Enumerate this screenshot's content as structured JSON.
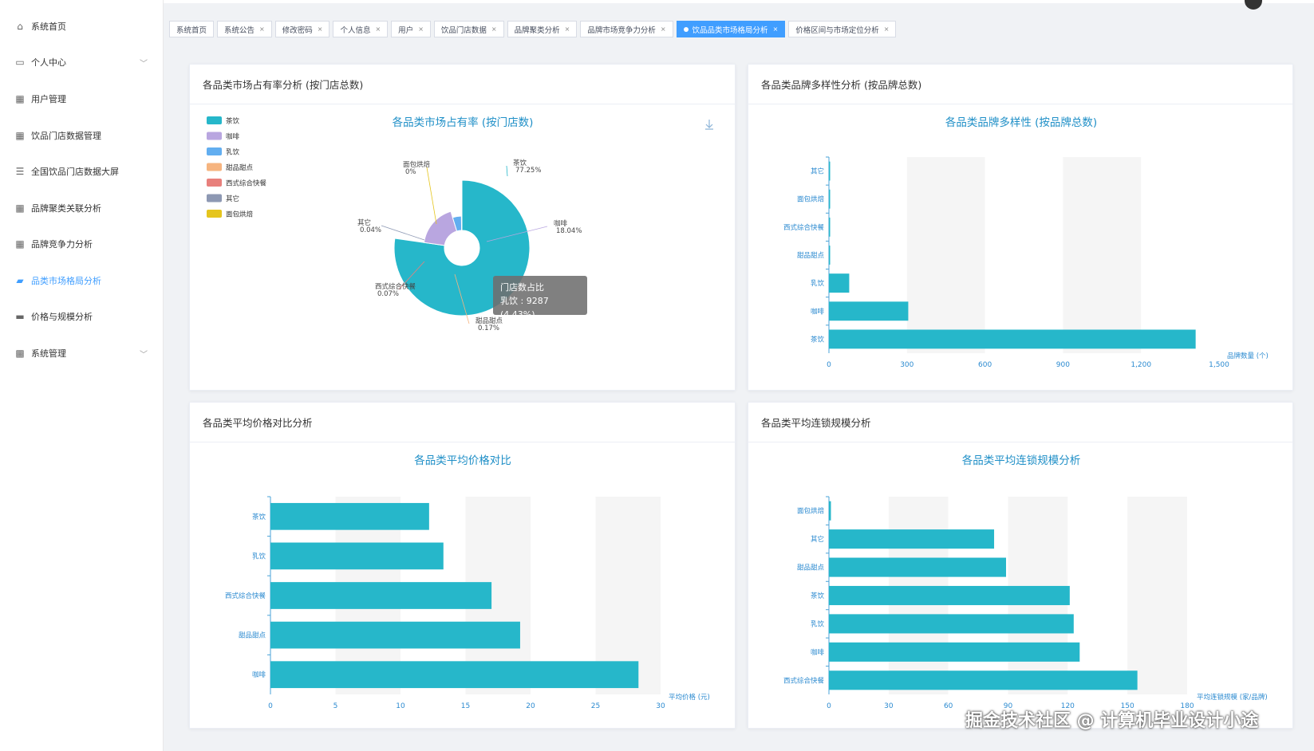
{
  "sidebar": {
    "items": [
      {
        "label": "系统首页",
        "icon": "home-icon"
      },
      {
        "label": "个人中心",
        "icon": "calendar-icon"
      },
      {
        "label": "用户管理",
        "icon": "grid-icon"
      },
      {
        "label": "饮品门店数据管理",
        "icon": "grid-icon"
      },
      {
        "label": "全国饮品门店数据大屏",
        "icon": "list-icon"
      },
      {
        "label": "品牌聚类关联分析",
        "icon": "grid-icon"
      },
      {
        "label": "品牌竞争力分析",
        "icon": "grid-icon"
      },
      {
        "label": "品类市场格局分析",
        "icon": "chat-icon"
      },
      {
        "label": "价格与规模分析",
        "icon": "monitor-icon"
      },
      {
        "label": "系统管理",
        "icon": "settings-icon"
      }
    ]
  },
  "tabs": [
    "系统首页",
    "系统公告",
    "修改密码",
    "个人信息",
    "用户",
    "饮品门店数据",
    "品牌聚类分析",
    "品牌市场竞争力分析",
    "饮品品类市场格局分析",
    "价格区间与市场定位分析"
  ],
  "cards": {
    "c1": {
      "title": "各品类市场占有率分析 (按门店总数)"
    },
    "c2": {
      "title": "各品类品牌多样性分析 (按品牌总数)"
    },
    "c3": {
      "title": "各品类平均价格对比分析"
    },
    "c4": {
      "title": "各品类平均连锁规模分析"
    }
  },
  "tooltip": {
    "title": "门店数占比",
    "value": "乳饮 : 9287 (4.43%)"
  },
  "watermark": "掘金技术社区 @ 计算机毕业设计小途",
  "colors": {
    "accent": "#409eff",
    "bar": "#26b7ca",
    "title": "#1f8fc7"
  },
  "chart_data": [
    {
      "type": "pie",
      "title": "各品类市场占有率 (按门店数)",
      "legend": [
        "茶饮",
        "咖啡",
        "乳饮",
        "甜品甜点",
        "西式综合快餐",
        "其它",
        "面包烘焙"
      ],
      "legend_colors": [
        "#26b7ca",
        "#b9a6e0",
        "#62aef0",
        "#f6b47f",
        "#e8807c",
        "#8d98b3",
        "#e5c51e"
      ],
      "slices": [
        {
          "name": "茶饮",
          "percent": 77.25,
          "label": "77.25%"
        },
        {
          "name": "咖啡",
          "percent": 18.04,
          "label": "18.04%"
        },
        {
          "name": "乳饮",
          "percent": 4.43,
          "label": "4.43%"
        },
        {
          "name": "甜品甜点",
          "percent": 0.17,
          "label": "0.17%"
        },
        {
          "name": "西式综合快餐",
          "percent": 0.07,
          "label": "0.07%"
        },
        {
          "name": "其它",
          "percent": 0.04,
          "label": "0.04%"
        },
        {
          "name": "面包烘焙",
          "percent": 0,
          "label": "0%"
        }
      ]
    },
    {
      "type": "bar",
      "title": "各品类品牌多样性 (按品牌总数)",
      "categories": [
        "其它",
        "面包烘焙",
        "西式综合快餐",
        "甜品甜点",
        "乳饮",
        "咖啡",
        "茶饮"
      ],
      "values": [
        2,
        1,
        2,
        3,
        78,
        305,
        1410
      ],
      "xlabel": "品牌数量 (个)",
      "ticks": [
        "0",
        "300",
        "600",
        "900",
        "1,200",
        "1,500"
      ],
      "xlim": [
        0,
        1500
      ]
    },
    {
      "type": "bar",
      "title": "各品类平均价格对比",
      "categories": [
        "茶饮",
        "乳饮",
        "西式综合快餐",
        "甜品甜点",
        "咖啡"
      ],
      "values": [
        12.2,
        13.3,
        17,
        19.2,
        28.3
      ],
      "xlabel": "平均价格 (元)",
      "ticks": [
        "0",
        "5",
        "10",
        "15",
        "20",
        "25",
        "30"
      ],
      "xlim": [
        0,
        30
      ]
    },
    {
      "type": "bar",
      "title": "各品类平均连锁规模分析",
      "categories": [
        "面包烘焙",
        "其它",
        "甜品甜点",
        "茶饮",
        "乳饮",
        "咖啡",
        "西式综合快餐"
      ],
      "values": [
        1,
        83,
        89,
        121,
        123,
        126,
        155
      ],
      "xlabel": "平均连锁规模 (家/品牌)",
      "ticks": [
        "0",
        "30",
        "60",
        "90",
        "120",
        "150",
        "180"
      ],
      "xlim": [
        0,
        180
      ]
    }
  ]
}
